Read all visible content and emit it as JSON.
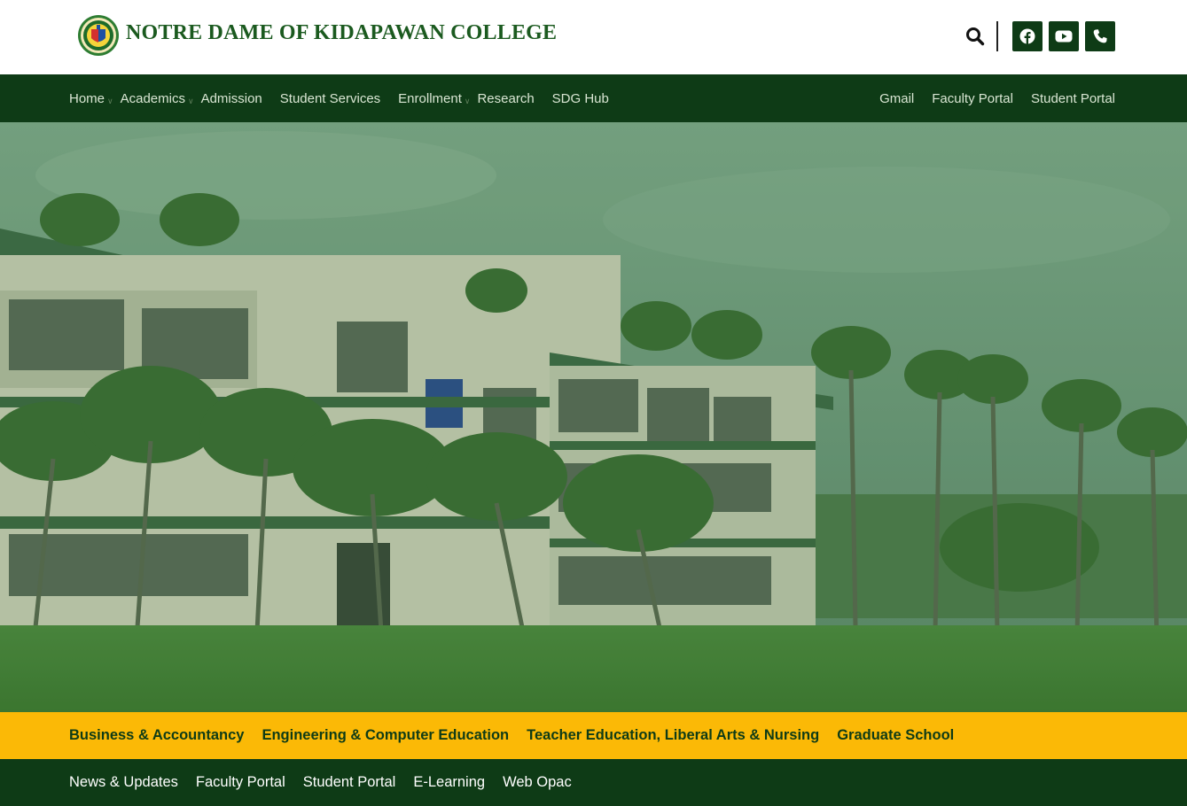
{
  "header": {
    "college_name": "NOTRE DAME OF KIDAPAWAN COLLEGE",
    "logo_icon": "college-seal-icon",
    "search_icon": "search-icon",
    "social": [
      {
        "name": "facebook-icon"
      },
      {
        "name": "youtube-icon"
      },
      {
        "name": "phone-icon"
      }
    ]
  },
  "main_nav": {
    "left": [
      {
        "label": "Home",
        "dropdown": true
      },
      {
        "label": "Academics",
        "dropdown": true
      },
      {
        "label": "Admission",
        "dropdown": false
      },
      {
        "label": "Student Services",
        "dropdown": false
      },
      {
        "label": "Enrollment",
        "dropdown": true
      },
      {
        "label": "Research",
        "dropdown": false
      },
      {
        "label": "SDG Hub",
        "dropdown": false
      }
    ],
    "right": [
      {
        "label": "Gmail"
      },
      {
        "label": "Faculty Portal"
      },
      {
        "label": "Student Portal"
      }
    ]
  },
  "colleges": [
    "Business & Accountancy",
    "Engineering & Computer Education",
    "Teacher Education, Liberal Arts & Nursing",
    "Graduate School"
  ],
  "bottom_nav": [
    "News & Updates",
    "Faculty Portal",
    "Student Portal",
    "E-Learning",
    "Web Opac"
  ],
  "colors": {
    "dark_green": "#0e3b16",
    "brand_green": "#1b5a1f",
    "gold": "#fbb906"
  }
}
